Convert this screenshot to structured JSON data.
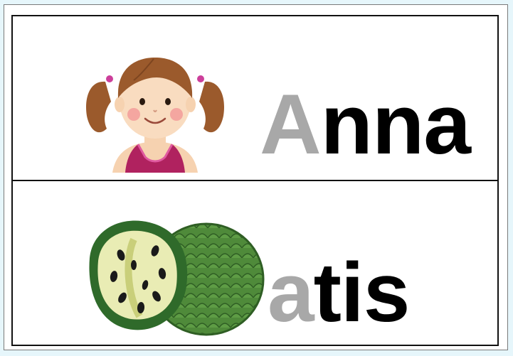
{
  "cards": [
    {
      "word_first": "A",
      "word_rest": "nna",
      "picture": "girl-with-pigtails-icon"
    },
    {
      "word_first": "a",
      "word_rest": "tis",
      "picture": "atis-fruit-icon"
    }
  ],
  "colors": {
    "first_letter": "#a8a8a8",
    "rest_letters": "#000000",
    "border": "#111111",
    "background": "#e6f6fb"
  }
}
